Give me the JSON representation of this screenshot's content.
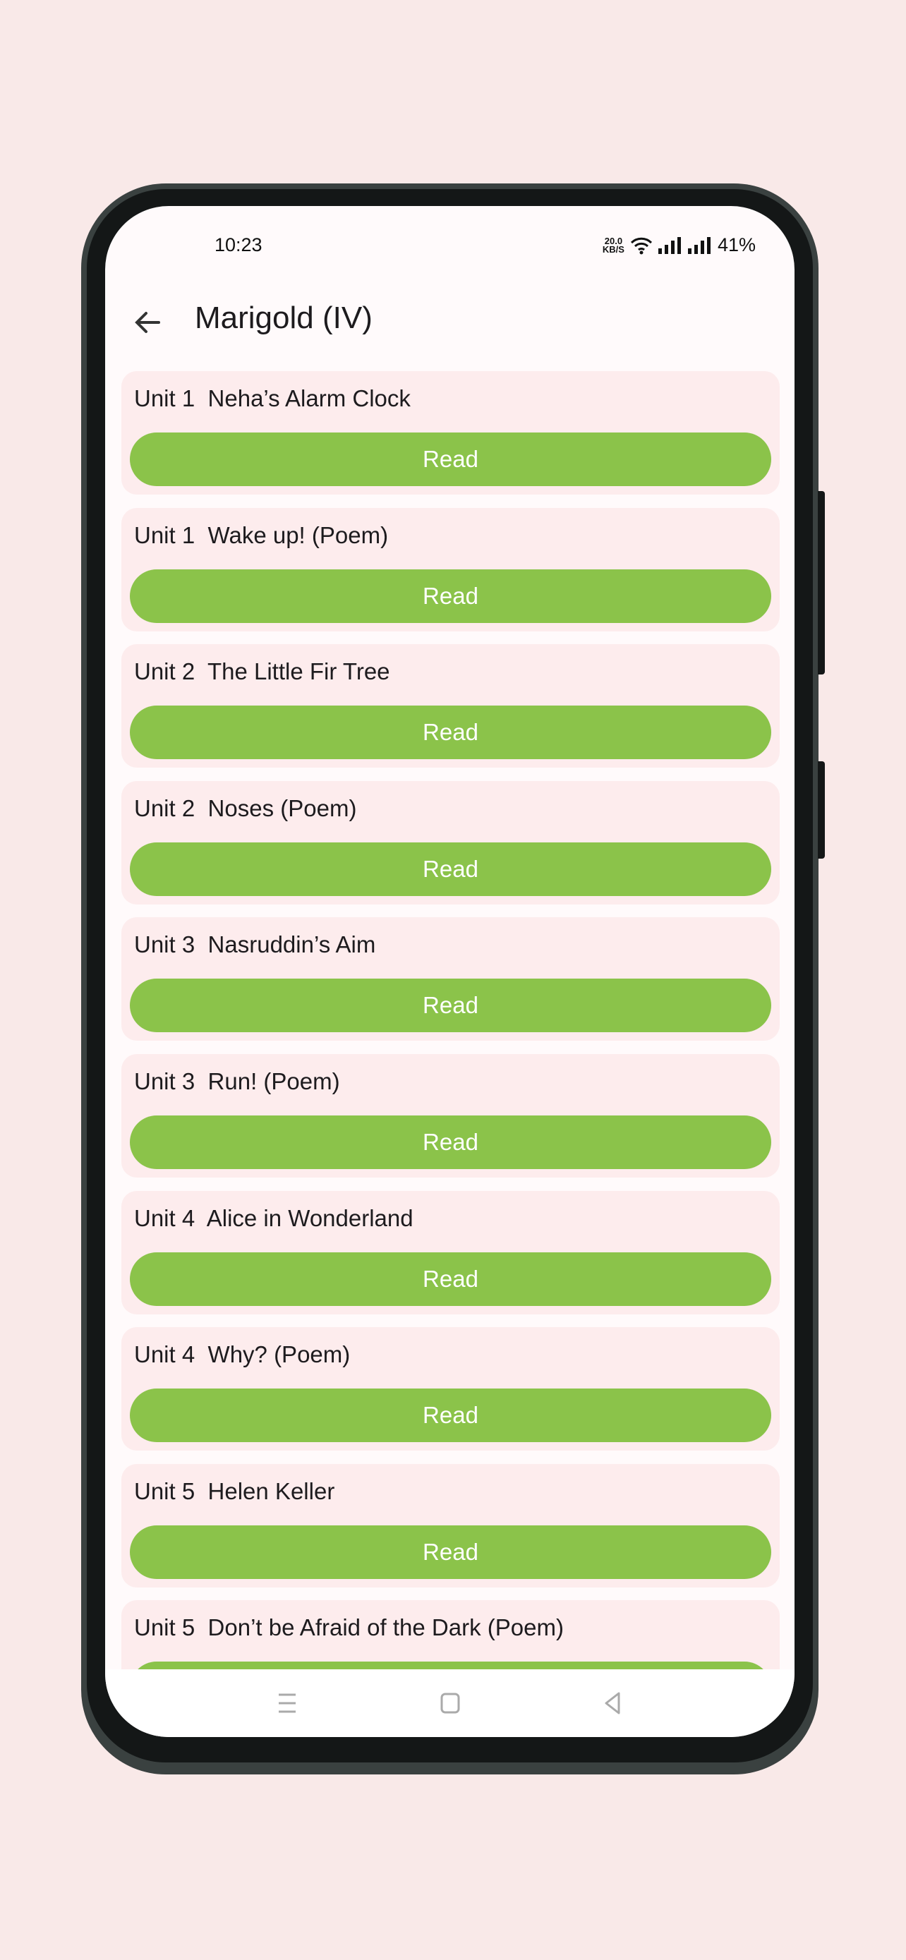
{
  "status_bar": {
    "time": "10:23",
    "net_speed": "20.0",
    "net_unit": "KB/S",
    "battery": "41%"
  },
  "app_bar": {
    "title": "Marigold (IV)",
    "back_icon": "arrow-left-icon"
  },
  "colors": {
    "button": "#8bc34a",
    "card": "#fdeced",
    "background": "#f9e9e8"
  },
  "lessons": [
    {
      "title": "Unit 1  Neha’s Alarm Clock",
      "button": "Read"
    },
    {
      "title": "Unit 1  Wake up! (Poem)",
      "button": "Read"
    },
    {
      "title": "Unit 2  The Little Fir Tree",
      "button": "Read"
    },
    {
      "title": "Unit 2  Noses (Poem)",
      "button": "Read"
    },
    {
      "title": "Unit 3  Nasruddin’s Aim",
      "button": "Read"
    },
    {
      "title": "Unit 3  Run! (Poem)",
      "button": "Read"
    },
    {
      "title": "Unit 4  Alice in Wonderland",
      "button": "Read"
    },
    {
      "title": "Unit 4  Why? (Poem)",
      "button": "Read"
    },
    {
      "title": "Unit 5  Helen Keller",
      "button": "Read"
    },
    {
      "title": "Unit 5  Don’t be Afraid of the Dark (Poem)",
      "button": "Read"
    }
  ]
}
